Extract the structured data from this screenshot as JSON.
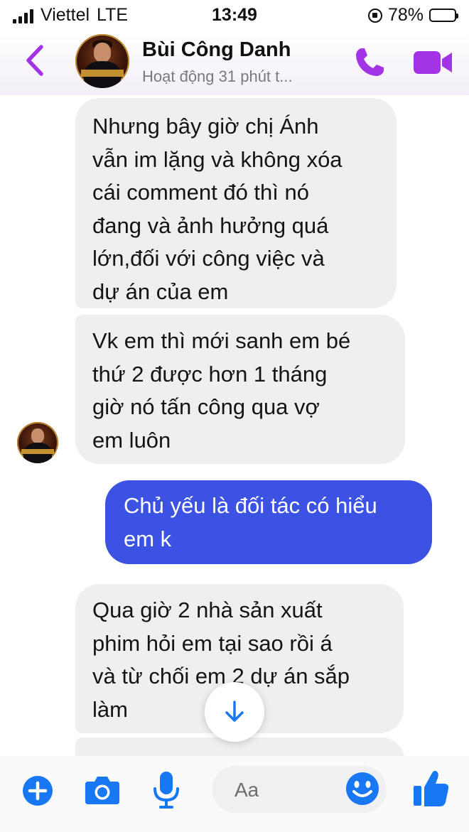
{
  "status_bar": {
    "carrier": "Viettel",
    "network": "LTE",
    "time": "13:49",
    "battery_percent": "78%",
    "battery_level": 0.78
  },
  "header": {
    "back_icon": "chevron-left-icon",
    "contact_name": "Bùi Công Danh",
    "contact_status": "Hoạt động 31 phút t...",
    "call_icon": "phone-icon",
    "video_icon": "video-camera-icon",
    "accent_color": "#a334e6"
  },
  "messages": [
    {
      "from": "contact",
      "lines": [
        "Nhưng bây giờ chị Ánh",
        "vẫn im lặng và không xóa",
        "cái comment đó thì nó",
        "đang và ảnh hưởng quá",
        "lớn,đối với công việc và",
        "dự án của em"
      ]
    },
    {
      "from": "contact",
      "lines": [
        "Vk em thì mới sanh em bé",
        "thứ 2 được hơn 1 tháng",
        "giờ nó tấn công qua vợ",
        "em luôn"
      ]
    },
    {
      "from": "me",
      "lines": [
        "Chủ yếu là đối tác có hiểu",
        "em k"
      ]
    },
    {
      "from": "contact",
      "lines": [
        "Qua giờ 2 nhà sản xuất",
        "phim hỏi em tại sao rồi á",
        "và từ chối em 2 dự án sắp",
        "làm"
      ]
    }
  ],
  "composer": {
    "placeholder": "Aa",
    "icons": [
      "plus-icon",
      "camera-icon",
      "microphone-icon",
      "emoji-icon",
      "thumbs-up-icon"
    ],
    "accent_color": "#1877f2"
  },
  "colors": {
    "incoming_bubble": "#efeff1",
    "outgoing_bubble": "#3b52e3"
  }
}
